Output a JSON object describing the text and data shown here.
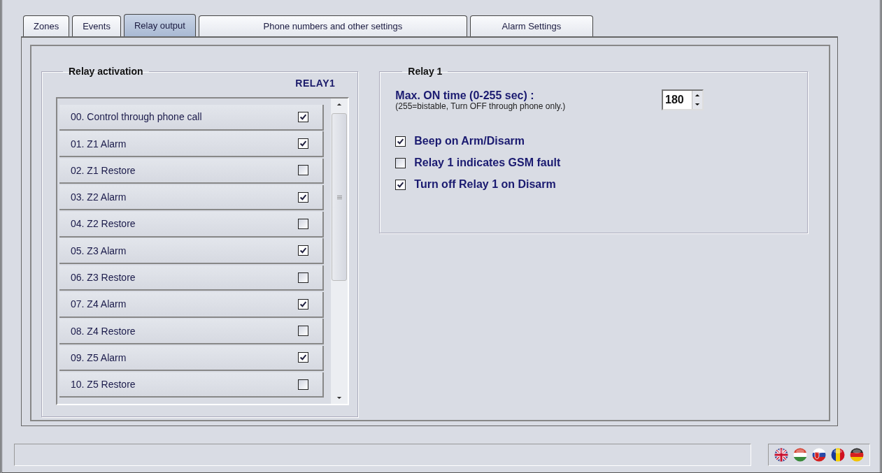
{
  "tabs": [
    {
      "label": "Zones",
      "selected": false
    },
    {
      "label": "Events",
      "selected": false
    },
    {
      "label": "Relay output",
      "selected": true
    },
    {
      "label": "Phone numbers and other settings",
      "selected": false
    },
    {
      "label": "Alarm Settings",
      "selected": false
    }
  ],
  "relay_activation": {
    "title": "Relay activation",
    "column": "RELAY1",
    "rows": [
      {
        "label": "00. Control through phone call",
        "checked": true
      },
      {
        "label": "01. Z1 Alarm",
        "checked": true
      },
      {
        "label": "02. Z1 Restore",
        "checked": false
      },
      {
        "label": "03. Z2 Alarm",
        "checked": true
      },
      {
        "label": "04. Z2 Restore",
        "checked": false
      },
      {
        "label": "05. Z3 Alarm",
        "checked": true
      },
      {
        "label": "06. Z3 Restore",
        "checked": false
      },
      {
        "label": "07. Z4 Alarm",
        "checked": true
      },
      {
        "label": "08. Z4 Restore",
        "checked": false
      },
      {
        "label": "09. Z5 Alarm",
        "checked": true
      },
      {
        "label": "10. Z5 Restore",
        "checked": false
      }
    ]
  },
  "relay_1": {
    "title": "Relay 1",
    "max_on_time": {
      "label": "Max. ON time (0-255 sec) :",
      "hint": "(255=bistable, Turn OFF through phone only.)",
      "value": "180"
    },
    "options": [
      {
        "label": "Beep on Arm/Disarm",
        "checked": true
      },
      {
        "label": "Relay 1 indicates GSM fault",
        "checked": false
      },
      {
        "label": "Turn off Relay 1 on Disarm",
        "checked": true
      }
    ]
  },
  "languages": [
    {
      "kind": "uk"
    },
    {
      "kind": "hu"
    },
    {
      "kind": "sk"
    },
    {
      "kind": "ro"
    },
    {
      "kind": "de"
    }
  ]
}
